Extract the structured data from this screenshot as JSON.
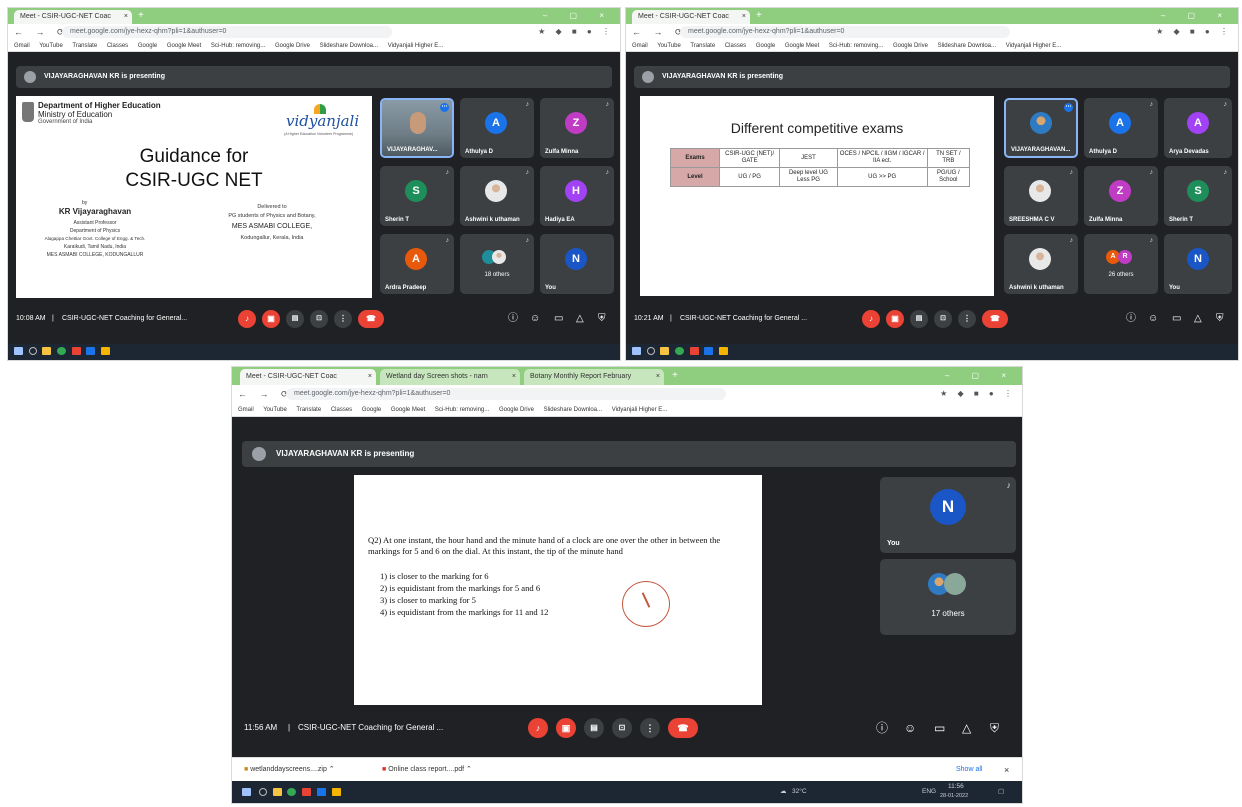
{
  "meet_presenting_suffix": "is presenting",
  "shot1": {
    "tab_title": "Meet - CSIR-UGC-NET Coac",
    "url": "meet.google.com/jye-hexz-qhm?pli=1&authuser=0",
    "bookmarks": [
      "Gmail",
      "YouTube",
      "Translate",
      "Classes",
      "Google",
      "Google Meet",
      "Sci-Hub: removing...",
      "Google Drive",
      "Slideshare Downloa...",
      "Vidyanjali Higher E..."
    ],
    "presenter": "VIJAYARAGHAVAN KR",
    "slide": {
      "dept": "Department of Higher Education",
      "ministry": "Ministry of Education",
      "govt": "Government of India",
      "logo_text": "vidyanjali",
      "logo_tagline": "(A Higher Education Volunteer Programme)",
      "title_line1": "Guidance for",
      "title_line2": "CSIR-UGC NET",
      "by": "by",
      "speaker": "KR Vijayaraghavan",
      "speaker_lines": [
        "Assistant Professor",
        "Department of Physics",
        "Alagappa Chettiar Govt. College of Engg. & Tech.",
        "Karaikudi, Tamil Nadu, India",
        "MES ASMABI COLLEGE, KODUNGALLUR"
      ],
      "delivered_to": "Delivered to",
      "audience": "PG students of Physics and Botany,",
      "college": "MES ASMABI COLLEGE,",
      "place": "Kodungallur, Kerala, India"
    },
    "tiles": [
      {
        "name": "VIJAYARAGHAV...",
        "letter": "",
        "color": "#6d7b86"
      },
      {
        "name": "Athulya D",
        "letter": "A",
        "color": "#1a73e8"
      },
      {
        "name": "Zulfa Minna",
        "letter": "Z",
        "color": "#c03cc5"
      },
      {
        "name": "Sherin T",
        "letter": "S",
        "color": "#1e8e5a"
      },
      {
        "name": "Ashwini k uthaman",
        "letter": "",
        "color": "#ffffff"
      },
      {
        "name": "Hadiya EA",
        "letter": "H",
        "color": "#a142f4"
      },
      {
        "name": "Ardra Pradeep",
        "letter": "A",
        "color": "#e8590c"
      },
      {
        "name": "18 others",
        "letter": "",
        "color": "#1e8e9a"
      },
      {
        "name": "You",
        "letter": "N",
        "color": "#1a56c6"
      }
    ],
    "time": "10:08 AM",
    "meeting": "CSIR-UGC-NET Coaching for General..."
  },
  "shot2": {
    "tab_title": "Meet - CSIR-UGC-NET Coac",
    "url": "meet.google.com/jye-hexz-qhm?pli=1&authuser=0",
    "presenter": "VIJAYARAGHAVAN KR",
    "slide_title": "Different competitive exams",
    "table": {
      "header": [
        "Exams",
        "CSIR-UGC (NET)/ GATE",
        "JEST",
        "OCES / NPCIL / IIGM / IGCAR / IIA ect.",
        "TN SET / TRB"
      ],
      "row": [
        "Level",
        "UG / PG",
        "Deep level UG Less PG",
        "UG >> PG",
        "PG/UG / School"
      ]
    },
    "tiles": [
      {
        "name": "VIJAYARAGHAVAN...",
        "letter": "",
        "color": "#ffffff"
      },
      {
        "name": "Athulya D",
        "letter": "A",
        "color": "#1a73e8"
      },
      {
        "name": "Arya Devadas",
        "letter": "A",
        "color": "#a142f4"
      },
      {
        "name": "SREESHMA C V",
        "letter": "",
        "color": "#ffffff"
      },
      {
        "name": "Zulfa Minna",
        "letter": "Z",
        "color": "#c03cc5"
      },
      {
        "name": "Sherin T",
        "letter": "S",
        "color": "#1e8e5a"
      },
      {
        "name": "Ashwini k uthaman",
        "letter": "",
        "color": "#ffffff"
      },
      {
        "name": "26 others",
        "letter": "",
        "color": "#e8590c"
      },
      {
        "name": "You",
        "letter": "N",
        "color": "#1a56c6"
      }
    ],
    "time": "10:21 AM",
    "meeting": "CSIR-UGC-NET Coaching for General ..."
  },
  "shot3": {
    "tabs": [
      "Meet - CSIR-UGC-NET Coac",
      "Wetland day Screen shots - narn",
      "Botany Monthly Report February"
    ],
    "url": "meet.google.com/jye-hexz-qhm?pli=1&authuser=0",
    "presenter": "VIJAYARAGHAVAN KR",
    "question": "Q2) At one instant, the hour hand and the minute hand of a clock are one over the other in between the markings for 5 and 6 on the dial.  At this instant, the tip of the minute hand",
    "options": [
      "1) is closer to the marking for 6",
      "2) is equidistant from the markings for 5 and 6",
      "3) is closer to marking for 5",
      "4) is equidistant from the markings for 11 and 12"
    ],
    "you_letter": "N",
    "you_label": "You",
    "others": "17 others",
    "time": "11:56 AM",
    "meeting": "CSIR-UGC-NET Coaching for General ...",
    "downloads": [
      "wetlanddayscreens....zip",
      "Online class report....pdf"
    ],
    "show_all": "Show all",
    "weather": "32°C",
    "lang": "ENG",
    "clock": "11:56",
    "date": "28-01-2022"
  }
}
